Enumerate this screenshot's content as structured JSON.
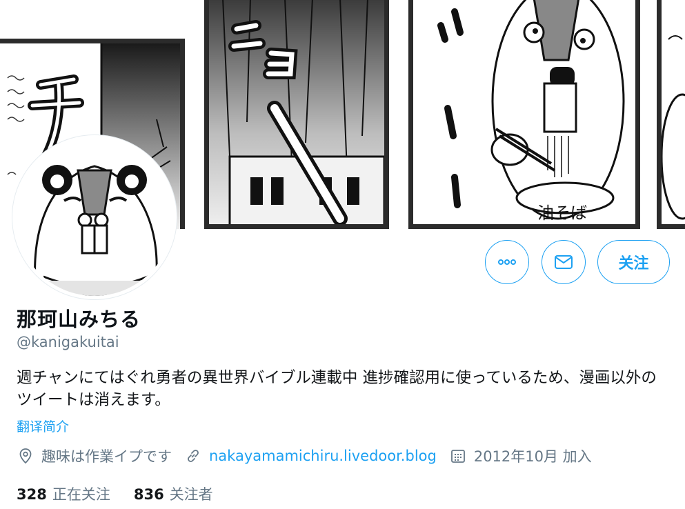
{
  "profile": {
    "name": "那珂山みちる",
    "handle": "@kanigakuitai",
    "bio": "週チャンにてはぐれ勇者の異世界バイブル連載中 進捗確認用に使っているため、漫画以外のツイートは消えます。",
    "translate_label": "翻译简介",
    "location": "趣味は作業イプです",
    "website": "nakayamamichiru.livedoor.blog",
    "joined": "2012年10月 加入"
  },
  "counts": {
    "following_number": "328",
    "following_label": "正在关注",
    "followers_number": "836",
    "followers_label": "关注者"
  },
  "actions": {
    "follow_label": "关注"
  },
  "banner": {
    "sfx_text": "ニョ",
    "bowl_text": "油そば"
  },
  "icons": {
    "more": "more-dots-icon",
    "message": "envelope-icon",
    "location": "location-pin-icon",
    "link": "link-icon",
    "calendar": "calendar-icon"
  },
  "colors": {
    "accent": "#1da1f2",
    "secondary_text": "#657786",
    "primary_text": "#14171a"
  }
}
